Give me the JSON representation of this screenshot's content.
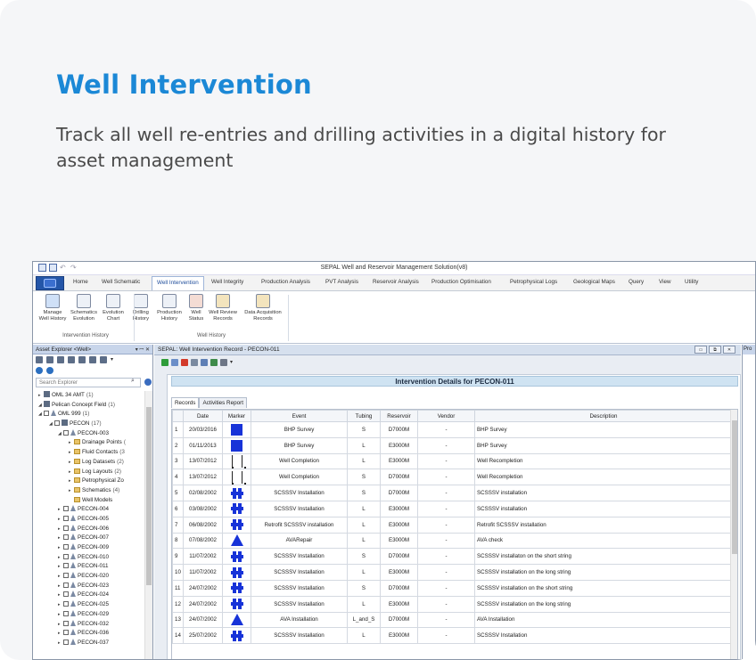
{
  "hero": {
    "title": "Well Intervention",
    "description": "Track all well re-entries and drilling activities in a digital history for asset management"
  },
  "app": {
    "window_title": "SEPAL Well and Reservoir Management Solution(v8)",
    "ribbon_tabs": [
      "Home",
      "Well Schematic",
      "Well Intervention",
      "Well Integrity",
      "Production Analysis",
      "PVT Analysis",
      "Reservoir Analysis",
      "Production Optimisation",
      "Petrophysical Logs",
      "Geological Maps",
      "Query",
      "View",
      "Utility"
    ],
    "active_tab": "Well Intervention",
    "ribbon_buttons": [
      {
        "line1": "Manage",
        "line2": "Well History"
      },
      {
        "line1": "Schematics",
        "line2": "Evolution"
      },
      {
        "line1": "Evolution",
        "line2": "Chart"
      },
      {
        "line1": "Drilling",
        "line2": "History"
      },
      {
        "line1": "Production",
        "line2": "History"
      },
      {
        "line1": "Well",
        "line2": "Status"
      },
      {
        "line1": "Well Review",
        "line2": "Records"
      },
      {
        "line1": "Data Acquisition",
        "line2": "Records"
      }
    ],
    "ribbon_groups": [
      "Intervention History",
      "Well History"
    ]
  },
  "explorer": {
    "title": "Asset Explorer <Well>",
    "pane_buttons": "▾ ꟷ ✕",
    "search_placeholder": "Search Explorer",
    "tree": [
      {
        "label": "OML 34 AMT",
        "count": "(1)",
        "level": 0,
        "icon": "grid",
        "twisty": "▸"
      },
      {
        "label": "Pelican Concept Field",
        "count": "(1)",
        "level": 0,
        "icon": "grid",
        "twisty": "◢"
      },
      {
        "label": "OML 999",
        "count": "(1)",
        "level": 1,
        "icon": "well",
        "twisty": "◢",
        "cb": true
      },
      {
        "label": "PECON",
        "count": "(17)",
        "level": 2,
        "icon": "grid",
        "twisty": "◢",
        "cb": true
      },
      {
        "label": "PECON-003",
        "count": "",
        "level": 3,
        "icon": "well",
        "twisty": "◢",
        "cb": true
      },
      {
        "label": "Drainage Points",
        "count": "(",
        "level": 4,
        "icon": "folder",
        "twisty": "▸"
      },
      {
        "label": "Fluid Contacts",
        "count": "(3",
        "level": 4,
        "icon": "folder",
        "twisty": "▸"
      },
      {
        "label": "Log Datasets",
        "count": "(2)",
        "level": 4,
        "icon": "folder",
        "twisty": "▸"
      },
      {
        "label": "Log Layouts",
        "count": "(2)",
        "level": 4,
        "icon": "folder",
        "twisty": "▸"
      },
      {
        "label": "Petrophysical Zo",
        "count": "",
        "level": 4,
        "icon": "folder",
        "twisty": "▸"
      },
      {
        "label": "Schematics",
        "count": "(4)",
        "level": 4,
        "icon": "folder",
        "twisty": "▸"
      },
      {
        "label": "Well Models",
        "count": "",
        "level": 4,
        "icon": "folder",
        "twisty": ""
      },
      {
        "label": "PECON-004",
        "count": "",
        "level": 3,
        "icon": "well",
        "twisty": "▸",
        "cb": true
      },
      {
        "label": "PECON-005",
        "count": "",
        "level": 3,
        "icon": "well",
        "twisty": "▸",
        "cb": true
      },
      {
        "label": "PECON-006",
        "count": "",
        "level": 3,
        "icon": "well",
        "twisty": "▸",
        "cb": true
      },
      {
        "label": "PECON-007",
        "count": "",
        "level": 3,
        "icon": "well",
        "twisty": "▸",
        "cb": true
      },
      {
        "label": "PECON-009",
        "count": "",
        "level": 3,
        "icon": "well",
        "twisty": "▸",
        "cb": true
      },
      {
        "label": "PECON-010",
        "count": "",
        "level": 3,
        "icon": "well",
        "twisty": "▸",
        "cb": true
      },
      {
        "label": "PECON-011",
        "count": "",
        "level": 3,
        "icon": "well",
        "twisty": "▸",
        "cb": true
      },
      {
        "label": "PECON-020",
        "count": "",
        "level": 3,
        "icon": "well",
        "twisty": "▸",
        "cb": true
      },
      {
        "label": "PECON-023",
        "count": "",
        "level": 3,
        "icon": "well",
        "twisty": "▸",
        "cb": true
      },
      {
        "label": "PECON-024",
        "count": "",
        "level": 3,
        "icon": "well",
        "twisty": "▸",
        "cb": true
      },
      {
        "label": "PECON-025",
        "count": "",
        "level": 3,
        "icon": "well",
        "twisty": "▸",
        "cb": true
      },
      {
        "label": "PECON-029",
        "count": "",
        "level": 3,
        "icon": "well",
        "twisty": "▸",
        "cb": true
      },
      {
        "label": "PECON-032",
        "count": "",
        "level": 3,
        "icon": "well",
        "twisty": "▸",
        "cb": true
      },
      {
        "label": "PECON-036",
        "count": "",
        "level": 3,
        "icon": "well",
        "twisty": "▸",
        "cb": true
      },
      {
        "label": "PECON-037",
        "count": "",
        "level": 3,
        "icon": "well",
        "twisty": "▸",
        "cb": true
      }
    ]
  },
  "document": {
    "title": "SEPAL: Well Intervention Record - PECON-011",
    "banner": "Intervention Details for PECON-011",
    "subtabs": [
      "Records",
      "Activities Report"
    ],
    "columns": [
      "",
      "Date",
      "Marker",
      "Event",
      "Tubing",
      "Reservoir",
      "Vendor",
      "Description"
    ],
    "rows": [
      {
        "n": "1",
        "date": "20/03/2016",
        "marker": "square",
        "event": "BHP Survey",
        "tubing": "S",
        "reservoir": "D7000M",
        "vendor": "-",
        "description": "BHP Survey"
      },
      {
        "n": "2",
        "date": "01/11/2013",
        "marker": "square",
        "event": "BHP Survey",
        "tubing": "L",
        "reservoir": "E3000M",
        "vendor": "-",
        "description": "BHP Survey"
      },
      {
        "n": "3",
        "date": "13/07/2012",
        "marker": "completion",
        "event": "Well Completion",
        "tubing": "L",
        "reservoir": "E3000M",
        "vendor": "-",
        "description": "Well Recompletion"
      },
      {
        "n": "4",
        "date": "13/07/2012",
        "marker": "completion",
        "event": "Well Completion",
        "tubing": "S",
        "reservoir": "D7000M",
        "vendor": "-",
        "description": "Well Recompletion"
      },
      {
        "n": "5",
        "date": "02/08/2002",
        "marker": "scsssv",
        "event": "SCSSSV Installation",
        "tubing": "S",
        "reservoir": "D7000M",
        "vendor": "-",
        "description": "SCSSSV installation"
      },
      {
        "n": "6",
        "date": "03/08/2002",
        "marker": "scsssv",
        "event": "SCSSSV Installation",
        "tubing": "L",
        "reservoir": "E3000M",
        "vendor": "-",
        "description": "SCSSSV installation"
      },
      {
        "n": "7",
        "date": "06/08/2002",
        "marker": "scsssv",
        "event": "Retrofit SCSSSV installation",
        "tubing": "L",
        "reservoir": "E3000M",
        "vendor": "-",
        "description": "Retrofit SCSSSV installation"
      },
      {
        "n": "8",
        "date": "07/08/2002",
        "marker": "triangle",
        "event": "AVARepair",
        "tubing": "L",
        "reservoir": "E3000M",
        "vendor": "-",
        "description": "AVA check"
      },
      {
        "n": "9",
        "date": "11/07/2002",
        "marker": "scsssv",
        "event": "SCSSSV Installation",
        "tubing": "S",
        "reservoir": "D7000M",
        "vendor": "-",
        "description": "SCSSSV installaton on the short string"
      },
      {
        "n": "10",
        "date": "11/07/2002",
        "marker": "scsssv",
        "event": "SCSSSV Installation",
        "tubing": "L",
        "reservoir": "E3000M",
        "vendor": "-",
        "description": "SCSSSV installation on the long string"
      },
      {
        "n": "11",
        "date": "24/07/2002",
        "marker": "scsssv",
        "event": "SCSSSV Installation",
        "tubing": "S",
        "reservoir": "D7000M",
        "vendor": "-",
        "description": "SCSSSV installation on the short string"
      },
      {
        "n": "12",
        "date": "24/07/2002",
        "marker": "scsssv",
        "event": "SCSSSV Installation",
        "tubing": "L",
        "reservoir": "E3000M",
        "vendor": "-",
        "description": "SCSSSV installation on the long string"
      },
      {
        "n": "13",
        "date": "24/07/2002",
        "marker": "triangle",
        "event": "AVA Installation",
        "tubing": "L_and_S",
        "reservoir": "D7000M",
        "vendor": "-",
        "description": "AVA Installation"
      },
      {
        "n": "14",
        "date": "25/07/2002",
        "marker": "scsssv",
        "event": "SCSSSV Installation",
        "tubing": "L",
        "reservoir": "E3000M",
        "vendor": "-",
        "description": "SCSSSV Installation"
      }
    ],
    "window_buttons": [
      "▭",
      "⧉",
      "✕"
    ]
  },
  "right_pane": {
    "title": "Pro"
  },
  "colors": {
    "accent": "#1b88d6",
    "marker": "#1733d8",
    "ribbon_blue": "#2456a8"
  }
}
